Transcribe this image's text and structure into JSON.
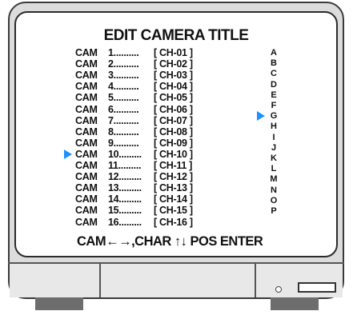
{
  "title": "EDIT CAMERA TITLE",
  "cameras": [
    {
      "cam": "CAM",
      "num": "1..........",
      "ch": "[  CH-01  ]"
    },
    {
      "cam": "CAM",
      "num": "2..........",
      "ch": "[  CH-02  ]"
    },
    {
      "cam": "CAM",
      "num": "3..........",
      "ch": "[  CH-03  ]"
    },
    {
      "cam": "CAM",
      "num": "4..........",
      "ch": "[  CH-04  ]"
    },
    {
      "cam": "CAM",
      "num": "5..........",
      "ch": "[  CH-05  ]"
    },
    {
      "cam": "CAM",
      "num": "6..........",
      "ch": "[  CH-06  ]"
    },
    {
      "cam": "CAM",
      "num": "7..........",
      "ch": "[  CH-07  ]"
    },
    {
      "cam": "CAM",
      "num": "8..........",
      "ch": "[  CH-08  ]"
    },
    {
      "cam": "CAM",
      "num": "9..........",
      "ch": "[  CH-09  ]"
    },
    {
      "cam": "CAM",
      "num": "10.........",
      "ch": "[  CH-10  ]"
    },
    {
      "cam": "CAM",
      "num": "11.........",
      "ch": "[  CH-11  ]"
    },
    {
      "cam": "CAM",
      "num": "12.........",
      "ch": "[  CH-12  ]"
    },
    {
      "cam": "CAM",
      "num": "13.........",
      "ch": "[  CH-13  ]"
    },
    {
      "cam": "CAM",
      "num": "14.........",
      "ch": "[  CH-14  ]"
    },
    {
      "cam": "CAM",
      "num": "15.........",
      "ch": "[  CH-15  ]"
    },
    {
      "cam": "CAM",
      "num": "16.........",
      "ch": "[  CH-16  ]"
    }
  ],
  "letters": [
    "A",
    "B",
    "C",
    "D",
    "E",
    "F",
    "G",
    "H",
    "I",
    "J",
    "K",
    "L",
    "M",
    "N",
    "O",
    "P"
  ],
  "selected_camera": "10",
  "selected_letter": "G",
  "footer": "CAM←→,CHAR ↑↓ POS ENTER",
  "colors": {
    "cursor": "#1e90ff",
    "text": "#111111",
    "bezel": "#dcdcdc"
  }
}
